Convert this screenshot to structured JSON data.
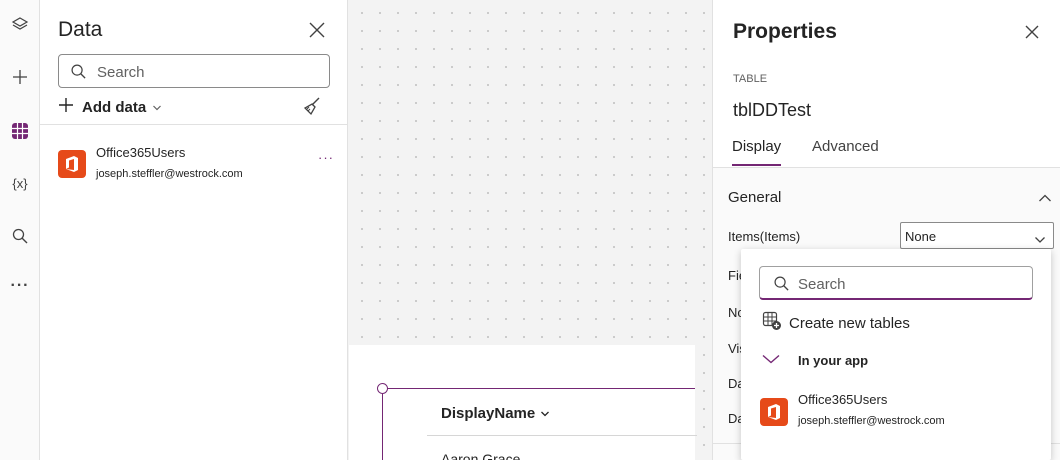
{
  "rail": {
    "items": [
      {
        "icon": "layers-icon"
      },
      {
        "icon": "plus-icon"
      },
      {
        "icon": "data-grid-icon",
        "active": true
      },
      {
        "icon": "variables-icon",
        "text": "{x}"
      },
      {
        "icon": "search-icon"
      },
      {
        "icon": "more-icon",
        "text": "···"
      }
    ],
    "accent": "#742774"
  },
  "data_pane": {
    "title": "Data",
    "search_placeholder": "Search",
    "add_data_label": "Add data",
    "connections": [
      {
        "name": "Office365Users",
        "account": "joseph.steffler@westrock.com",
        "more": "···"
      }
    ]
  },
  "canvas": {
    "table_column_header": "DisplayName",
    "first_row_value": "Aaron Grace"
  },
  "properties": {
    "title": "Properties",
    "control_type": "TABLE",
    "control_name": "tblDDTest",
    "tabs": [
      {
        "label": "Display",
        "active": true
      },
      {
        "label": "Advanced",
        "active": false
      }
    ],
    "section": "General",
    "rows": [
      {
        "label": "Items(Items)"
      },
      {
        "label": "Fie"
      },
      {
        "label": "No"
      },
      {
        "label": "Vis"
      },
      {
        "label": "Da"
      },
      {
        "label": "Da"
      }
    ],
    "items_value": "None"
  },
  "dropdown": {
    "search_placeholder": "Search",
    "create_label": "Create new tables",
    "group_label": "In your app",
    "items": [
      {
        "name": "Office365Users",
        "account": "joseph.steffler@westrock.com"
      }
    ]
  },
  "colors": {
    "accent": "#742774",
    "office_orange": "#e64a19"
  }
}
